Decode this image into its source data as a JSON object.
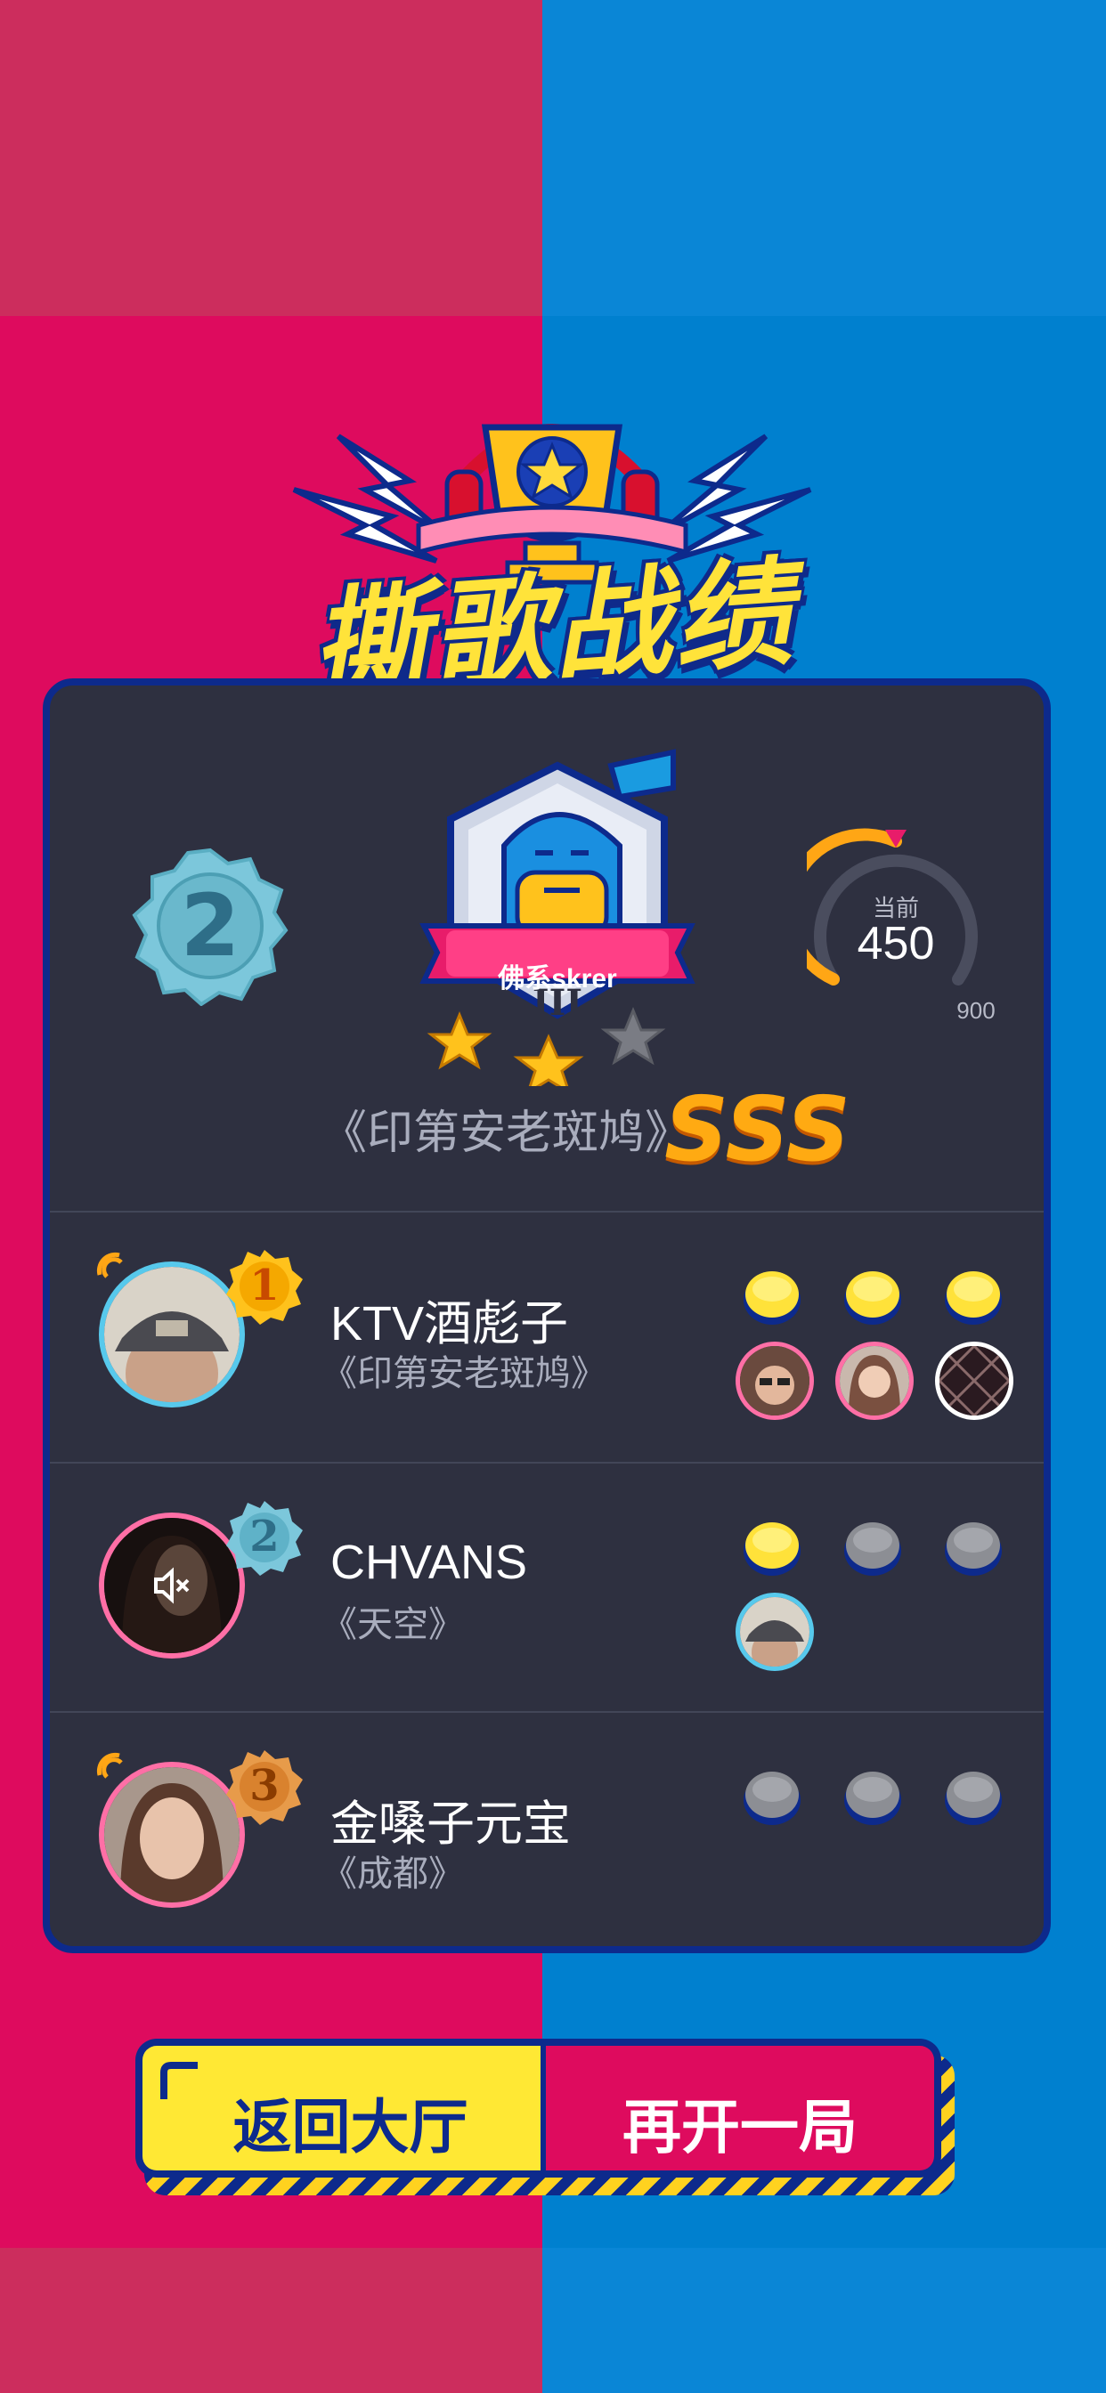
{
  "header": {
    "title": "撕歌战绩"
  },
  "result": {
    "rank": "2",
    "level_name": "佛系skrer",
    "level_tier": "III",
    "stars_earned": 2,
    "stars_total": 3,
    "score_label": "当前",
    "score": "450",
    "score_max": "900",
    "score_fraction": 0.5,
    "song": "《印第安老斑鸠》",
    "grade": "SSS"
  },
  "players": [
    {
      "rank": "1",
      "name": "KTV酒彪子",
      "song": "《印第安老斑鸠》",
      "muted": false,
      "speaking": true,
      "coins": [
        "gold",
        "gold",
        "gold"
      ],
      "voters": [
        "avatar-glasses",
        "avatar-girl",
        "avatar-pattern"
      ]
    },
    {
      "rank": "2",
      "name": "CHVANS",
      "song": "《天空》",
      "muted": true,
      "speaking": false,
      "coins": [
        "gold",
        "grey",
        "grey"
      ],
      "voters": [
        "avatar-cap"
      ]
    },
    {
      "rank": "3",
      "name": "金嗓子元宝",
      "song": "《成都》",
      "muted": false,
      "speaking": true,
      "coins": [
        "grey",
        "grey",
        "grey"
      ],
      "voters": []
    }
  ],
  "buttons": {
    "back": "返回大厅",
    "again": "再开一局"
  },
  "colors": {
    "left_bg": "#de0b5e",
    "right_bg": "#0080cf",
    "card_bg": "#2e3040",
    "border": "#0d2a8c",
    "accent_yellow": "#ffe834",
    "grade_orange": "#ffaa12"
  }
}
